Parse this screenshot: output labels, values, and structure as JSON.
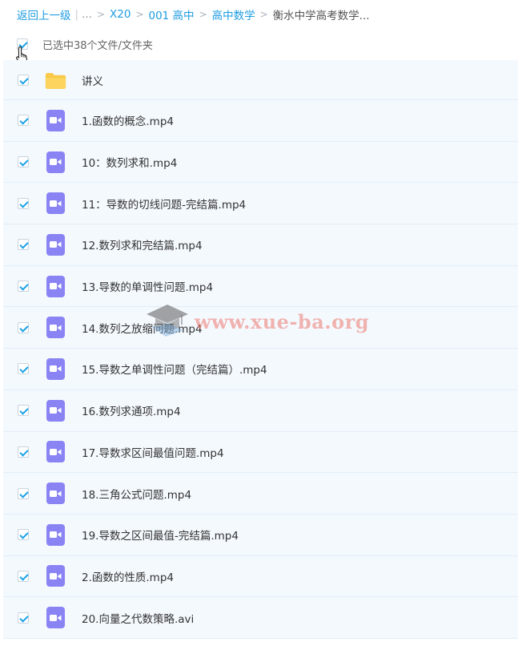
{
  "breadcrumb": {
    "back": "返回上一级",
    "ellipsis": "...",
    "items": [
      "X20",
      "001 高中",
      "高中数学"
    ],
    "current": "衡水中学高考数学..."
  },
  "selection": {
    "text": "已选中38个文件/文件夹",
    "all_checked": true
  },
  "files": [
    {
      "name": "讲义",
      "type": "folder",
      "checked": true
    },
    {
      "name": "1.函数的概念.mp4",
      "type": "video",
      "checked": true
    },
    {
      "name": "10：数列求和.mp4",
      "type": "video",
      "checked": true
    },
    {
      "name": "11：导数的切线问题-完结篇.mp4",
      "type": "video",
      "checked": true
    },
    {
      "name": "12.数列求和完结篇.mp4",
      "type": "video",
      "checked": true
    },
    {
      "name": "13.导数的单调性问题.mp4",
      "type": "video",
      "checked": true
    },
    {
      "name": "14.数列之放缩问题.mp4",
      "type": "video",
      "checked": true
    },
    {
      "name": "15.导数之单调性问题（完结篇）.mp4",
      "type": "video",
      "checked": true
    },
    {
      "name": "16.数列求通项.mp4",
      "type": "video",
      "checked": true
    },
    {
      "name": "17.导数求区间最值问题.mp4",
      "type": "video",
      "checked": true
    },
    {
      "name": "18.三角公式问题.mp4",
      "type": "video",
      "checked": true
    },
    {
      "name": "19.导数之区间最值-完结篇.mp4",
      "type": "video",
      "checked": true
    },
    {
      "name": "2.函数的性质.mp4",
      "type": "video",
      "checked": true
    },
    {
      "name": "20.向量之代数策略.avi",
      "type": "video",
      "checked": true
    }
  ],
  "watermark": {
    "text": "www.xue-ba.org",
    "icon": "graduation-cap-icon"
  },
  "colors": {
    "accent": "#1d9be0",
    "row_bg": "#f4f9fe",
    "video_icon": "#8a83f3",
    "folder_icon": "#f9c94a"
  }
}
